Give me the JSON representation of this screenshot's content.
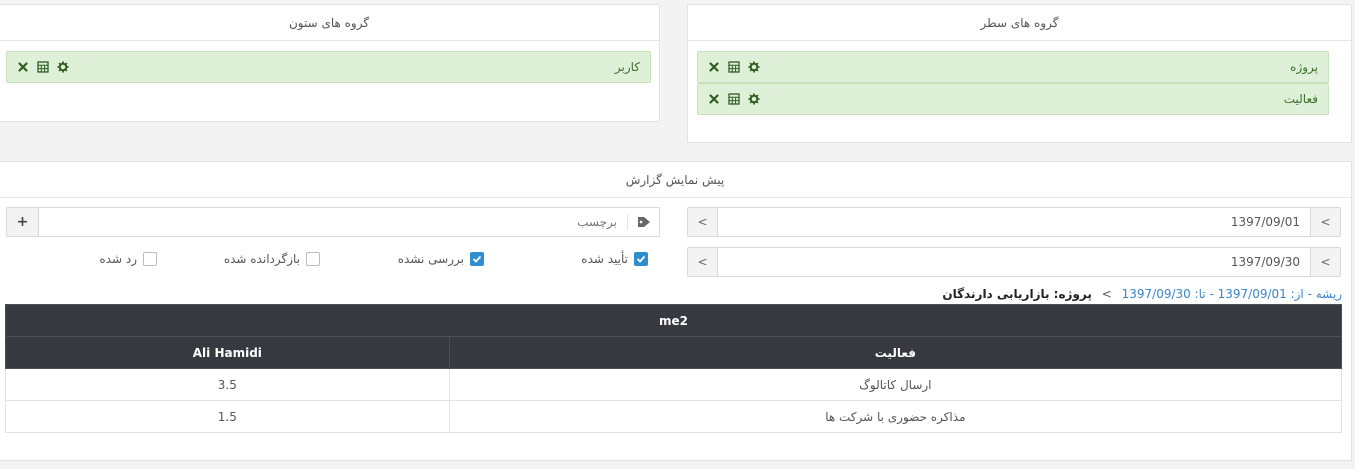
{
  "column_groups": {
    "title": "گروه های ستون",
    "items": [
      {
        "label": "کاربر"
      }
    ]
  },
  "row_groups": {
    "title": "گروه های سطر",
    "items": [
      {
        "label": "پروژه"
      },
      {
        "label": "فعالیت"
      }
    ]
  },
  "preview": {
    "title": "پیش نمایش گزارش",
    "date_from": "1397/09/01",
    "date_to": "1397/09/30",
    "prev_symbol": "<",
    "next_symbol": "<",
    "tag_placeholder": "برچسب",
    "add_symbol": "+",
    "status_filters": [
      {
        "label": "تأیید شده",
        "checked": true
      },
      {
        "label": "بررسی نشده",
        "checked": true
      },
      {
        "label": "بازگردانده شده",
        "checked": false
      },
      {
        "label": "رد شده",
        "checked": false
      }
    ],
    "breadcrumb": {
      "root": "ریشه - از: 1397/09/01 - تا: 1397/09/30",
      "separator": ">",
      "current": "پروژه: بازاریابی دارندگان"
    }
  },
  "report_table": {
    "group_header": "me2",
    "columns": [
      "فعالیت",
      "Ali Hamidi"
    ],
    "rows": [
      [
        "ارسال کاتالوگ",
        "3.5"
      ],
      [
        "مذاکره حضوری با شرکت ها",
        "1.5"
      ]
    ]
  },
  "colors": {
    "group_bg": "#dff0d8",
    "table_header": "#363a40",
    "checkbox_on": "#2f8ed0",
    "link": "#3a86c8"
  }
}
